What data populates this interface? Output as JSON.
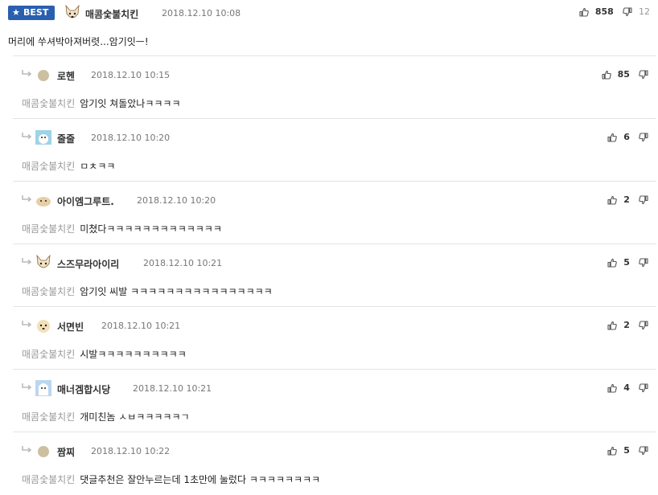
{
  "main": {
    "badge": "BEST",
    "nickname": "매콤숯불치킨",
    "date": "2018.12.10 10:08",
    "up": "858",
    "down": "12",
    "text": "머리에 쑤셔박아져버렷...암기잇ㅡ!"
  },
  "replies": [
    {
      "nickname": "로헨",
      "date": "2018.12.10 10:15",
      "up": "85",
      "quote": "매콤숯불치킨",
      "text": "암기잇 쳐돌았나ㅋㅋㅋㅋ"
    },
    {
      "nickname": "줄줄",
      "date": "2018.12.10 10:20",
      "up": "6",
      "quote": "매콤숯불치킨",
      "text": "ㅁㅊㅋㅋ"
    },
    {
      "nickname": "아이엠그루트.",
      "date": "2018.12.10 10:20",
      "up": "2",
      "quote": "매콤숯불치킨",
      "text": "미쳤다ㅋㅋㅋㅋㅋㅋㅋㅋㅋㅋㅋㅋㅋ"
    },
    {
      "nickname": "스즈무라아이리",
      "date": "2018.12.10 10:21",
      "up": "5",
      "quote": "매콤숯불치킨",
      "text": "암기잇 씨발 ㅋㅋㅋㅋㅋㅋㅋㅋㅋㅋㅋㅋㅋㅋㅋㅋ"
    },
    {
      "nickname": "서면빈",
      "date": "2018.12.10 10:21",
      "up": "2",
      "quote": "매콤숯불치킨",
      "text": "시발ㅋㅋㅋㅋㅋㅋㅋㅋㅋㅋ"
    },
    {
      "nickname": "매너겜합시당",
      "date": "2018.12.10 10:21",
      "up": "4",
      "quote": "매콤숯불치킨",
      "text": "개미친놈 ㅅㅂㅋㅋㅋㅋㅋㄱ"
    },
    {
      "nickname": "짬찌",
      "date": "2018.12.10 10:22",
      "up": "5",
      "quote": "매콤숯불치킨",
      "text": "댓글추천은 잘안누르는데 1초만에 눌렀다 ㅋㅋㅋㅋㅋㅋㅋㅋ"
    }
  ],
  "icons": {
    "thumb_up": "thumbs-up-icon",
    "thumb_down": "thumbs-down-icon",
    "reply_arrow": "reply-arrow-icon",
    "star": "star-icon"
  },
  "colors": {
    "best_badge": "#2a5fb0",
    "divider": "#e4e4e4",
    "quote": "#999999"
  }
}
